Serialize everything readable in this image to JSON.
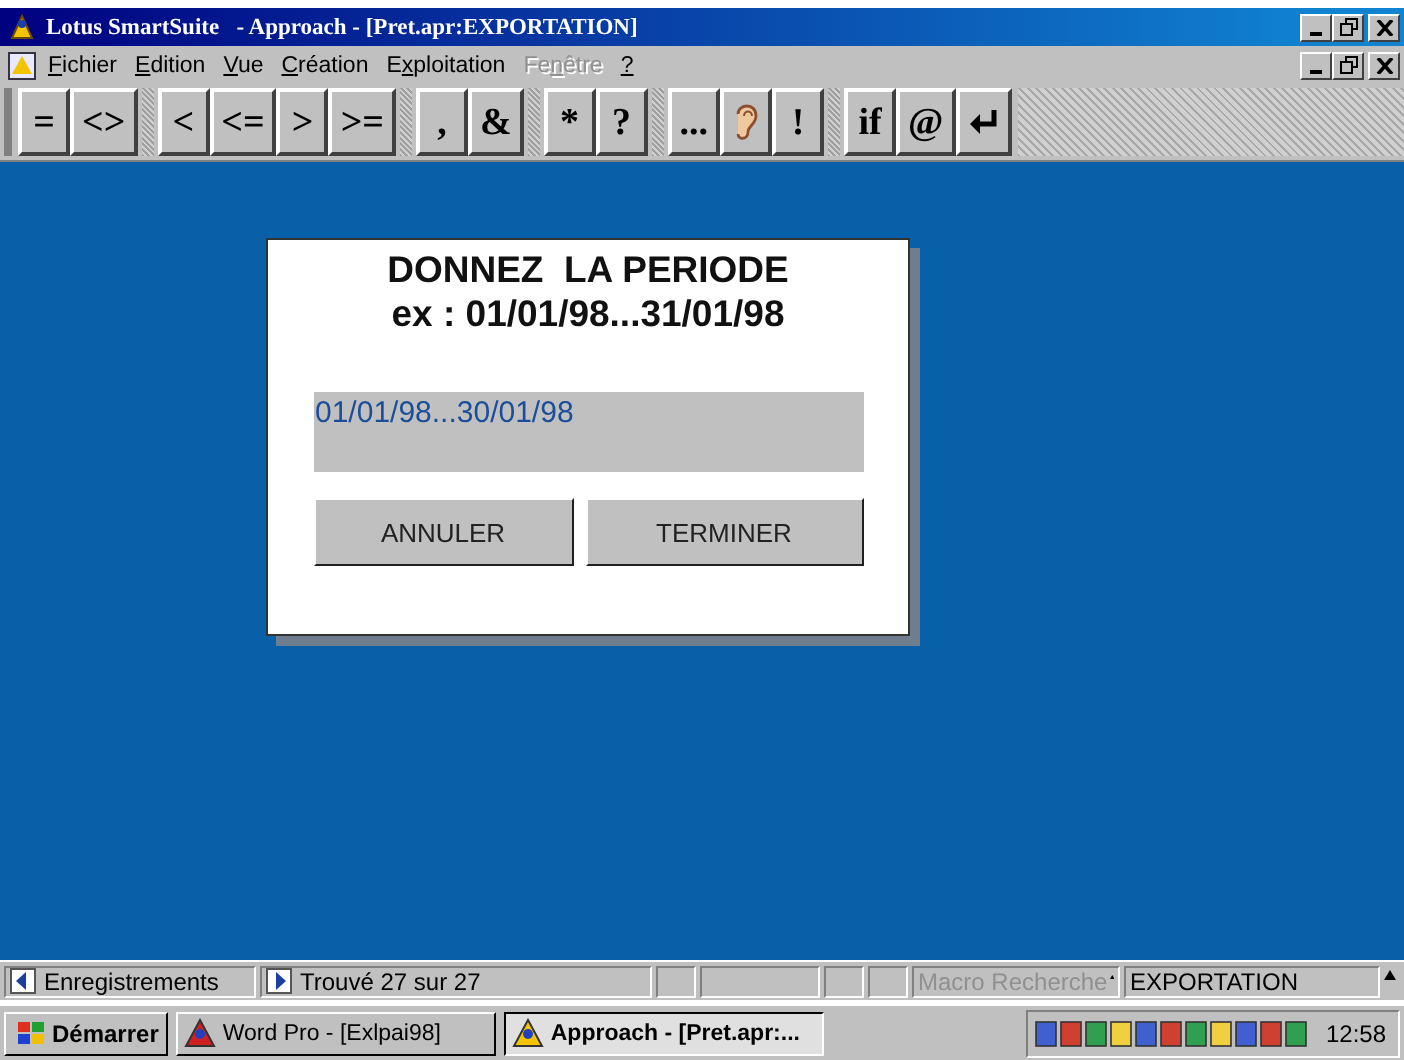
{
  "window": {
    "title": "Lotus SmartSuite   - Approach - [Pret.apr:EXPORTATION]"
  },
  "menu": [
    {
      "label": "Fichier",
      "disabled": false
    },
    {
      "label": "Edition",
      "disabled": false
    },
    {
      "label": "Vue",
      "disabled": false
    },
    {
      "label": "Création",
      "disabled": false
    },
    {
      "label": "Exploitation",
      "disabled": false
    },
    {
      "label": "Fenêtre",
      "disabled": true
    },
    {
      "label": "?",
      "disabled": false
    }
  ],
  "toolbar": [
    [
      {
        "kind": "text",
        "label": "="
      },
      {
        "kind": "text",
        "label": "<>"
      }
    ],
    [
      {
        "kind": "text",
        "label": "<"
      },
      {
        "kind": "text",
        "label": "<="
      },
      {
        "kind": "text",
        "label": ">"
      },
      {
        "kind": "text",
        "label": ">="
      }
    ],
    [
      {
        "kind": "text",
        "label": ","
      },
      {
        "kind": "text",
        "label": "&"
      }
    ],
    [
      {
        "kind": "text",
        "label": "*"
      },
      {
        "kind": "text",
        "label": "?"
      }
    ],
    [
      {
        "kind": "text",
        "label": "..."
      },
      {
        "kind": "ear"
      },
      {
        "kind": "text",
        "label": "!"
      }
    ],
    [
      {
        "kind": "text",
        "label": "if"
      },
      {
        "kind": "text",
        "label": "@"
      },
      {
        "kind": "enter"
      }
    ]
  ],
  "dialog": {
    "title_lines": [
      "DONNEZ  LA PERIODE",
      "ex : 01/01/98...31/01/98"
    ],
    "field": {
      "value": "01/01/98...30/01/98"
    },
    "buttons": [
      "ANNULER",
      "TERMINER"
    ]
  },
  "status_bar": {
    "records": "Enregistrements",
    "found": "Trouvé 27 sur 27",
    "macro": {
      "label": "Macro Recherche",
      "disabled": true
    },
    "view": "EXPORTATION"
  },
  "taskbar": {
    "start": "Démarrer",
    "tasks": [
      {
        "label": "Word Pro - [Exlpai98]",
        "selected": false
      },
      {
        "label": "Approach - [Pret.apr:...",
        "selected": true
      }
    ],
    "clock": "12:58"
  }
}
